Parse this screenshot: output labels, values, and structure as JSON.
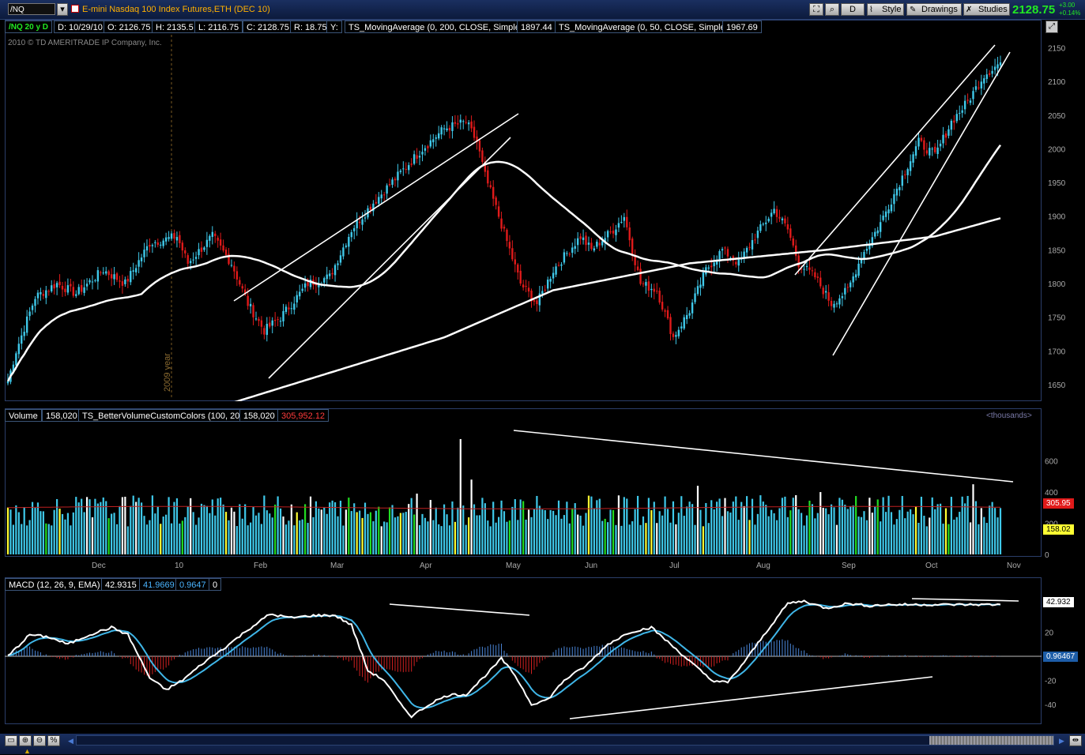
{
  "header": {
    "symbol": "/NQ",
    "title": "E-mini Nasdaq 100 Index Futures,ETH (DEC 10)",
    "period_button": "D",
    "style_label": "Style",
    "drawings_label": "Drawings",
    "studies_label": "Studies",
    "last_price": "2128.75",
    "change": "+3.00",
    "change_pct": "+0.14%"
  },
  "price_panel": {
    "aggregation": "/NQ 20 y D",
    "ohlc": {
      "date": "D: 10/29/10",
      "open": "O: 2126.75",
      "high": "H: 2135.5",
      "low": "L: 2116.75",
      "close": "C: 2128.75",
      "range": "R: 18.75",
      "y": "Y:"
    },
    "ma200_label": "TS_MovingAverage (0, 200, CLOSE, Simple)",
    "ma200_value": "1897.44",
    "ma50_label": "TS_MovingAverage (0, 50, CLOSE, Simple)",
    "ma50_value": "1967.69",
    "copyright": "2010 © TD AMERITRADE IP Company, Inc.",
    "year_marker": "2009 year"
  },
  "volume_panel": {
    "label": "Volume",
    "value": "158,020",
    "study": "TS_BetterVolumeCustomColors (100, 20)",
    "study_value": "158,020",
    "avg_value": "305,952.12",
    "units": "<thousands>",
    "avg_tag": "305.95",
    "vol_tag": "158.02"
  },
  "macd_panel": {
    "label": "MACD (12, 26, 9, EMA)",
    "value": "42.9315",
    "avg": "41.9669",
    "diff": "0.9647",
    "zero": "0",
    "value_tag": "42.932",
    "diff_tag": "0.96467"
  },
  "x_axis": [
    "Dec",
    "10",
    "Feb",
    "Mar",
    "Apr",
    "May",
    "Jun",
    "Jul",
    "Aug",
    "Sep",
    "Oct",
    "Nov"
  ],
  "colors": {
    "up": "#3fc9ea",
    "down": "#e01a1a",
    "ma": "#ffffff",
    "ma_dim": "#8b1a1a",
    "bg": "#000000"
  },
  "chart_data": [
    {
      "type": "candlestick",
      "ylim": [
        1630,
        2160
      ],
      "yticks": [
        1650,
        1700,
        1750,
        1800,
        1850,
        1900,
        1950,
        2000,
        2050,
        2100,
        2150
      ],
      "anchors": [
        [
          0,
          1655
        ],
        [
          3,
          1700
        ],
        [
          10,
          1780
        ],
        [
          18,
          1800
        ],
        [
          25,
          1785
        ],
        [
          35,
          1820
        ],
        [
          43,
          1800
        ],
        [
          52,
          1860
        ],
        [
          62,
          1870
        ],
        [
          66,
          1830
        ],
        [
          75,
          1870
        ],
        [
          82,
          1830
        ],
        [
          88,
          1770
        ],
        [
          94,
          1730
        ],
        [
          100,
          1750
        ],
        [
          110,
          1800
        ],
        [
          118,
          1810
        ],
        [
          126,
          1880
        ],
        [
          134,
          1920
        ],
        [
          143,
          1960
        ],
        [
          152,
          2000
        ],
        [
          160,
          2030
        ],
        [
          168,
          2040
        ],
        [
          172,
          2010
        ],
        [
          175,
          1960
        ],
        [
          180,
          1900
        ],
        [
          188,
          1800
        ],
        [
          194,
          1770
        ],
        [
          200,
          1820
        ],
        [
          210,
          1870
        ],
        [
          214,
          1850
        ],
        [
          222,
          1880
        ],
        [
          226,
          1900
        ],
        [
          232,
          1800
        ],
        [
          238,
          1790
        ],
        [
          244,
          1720
        ],
        [
          250,
          1760
        ],
        [
          256,
          1820
        ],
        [
          262,
          1850
        ],
        [
          268,
          1830
        ],
        [
          274,
          1870
        ],
        [
          281,
          1910
        ],
        [
          286,
          1880
        ],
        [
          290,
          1830
        ],
        [
          296,
          1810
        ],
        [
          302,
          1770
        ],
        [
          308,
          1790
        ],
        [
          313,
          1840
        ],
        [
          320,
          1890
        ],
        [
          327,
          1950
        ],
        [
          334,
          2010
        ],
        [
          340,
          1990
        ],
        [
          346,
          2040
        ],
        [
          352,
          2070
        ],
        [
          358,
          2110
        ],
        [
          364,
          2128
        ]
      ]
    },
    {
      "type": "bar",
      "name": "Volume",
      "yticks": [
        0,
        200,
        400,
        600
      ],
      "ylim": [
        0,
        760
      ],
      "spikes": [
        [
          43,
          370
        ],
        [
          82,
          300
        ],
        [
          150,
          390
        ],
        [
          166,
          740
        ],
        [
          170,
          480
        ],
        [
          253,
          440
        ],
        [
          298,
          400
        ],
        [
          354,
          450
        ]
      ],
      "base_low": 180,
      "base_high": 380
    },
    {
      "type": "line",
      "name": "MACD (12, 26, 9, EMA)",
      "yticks": [
        -40,
        -20,
        0,
        20
      ],
      "ylim": [
        -52,
        48
      ],
      "macd_anchors": [
        [
          0,
          0
        ],
        [
          8,
          18
        ],
        [
          15,
          16
        ],
        [
          22,
          10
        ],
        [
          30,
          18
        ],
        [
          38,
          24
        ],
        [
          44,
          18
        ],
        [
          52,
          -18
        ],
        [
          58,
          -28
        ],
        [
          64,
          -20
        ],
        [
          72,
          -5
        ],
        [
          80,
          8
        ],
        [
          88,
          22
        ],
        [
          96,
          35
        ],
        [
          104,
          32
        ],
        [
          112,
          34
        ],
        [
          120,
          34
        ],
        [
          126,
          26
        ],
        [
          132,
          -12
        ],
        [
          138,
          -20
        ],
        [
          144,
          -40
        ],
        [
          148,
          -50
        ],
        [
          156,
          -38
        ],
        [
          162,
          -32
        ],
        [
          168,
          -32
        ],
        [
          176,
          -14
        ],
        [
          181,
          -2
        ],
        [
          186,
          -16
        ],
        [
          192,
          -40
        ],
        [
          198,
          -36
        ],
        [
          204,
          -20
        ],
        [
          212,
          -8
        ],
        [
          220,
          10
        ],
        [
          228,
          20
        ],
        [
          236,
          24
        ],
        [
          242,
          12
        ],
        [
          250,
          -4
        ],
        [
          258,
          -20
        ],
        [
          264,
          -22
        ],
        [
          270,
          -5
        ],
        [
          278,
          20
        ],
        [
          286,
          44
        ],
        [
          292,
          46
        ],
        [
          300,
          40
        ],
        [
          308,
          44
        ],
        [
          316,
          42
        ],
        [
          322,
          43
        ]
      ]
    }
  ]
}
